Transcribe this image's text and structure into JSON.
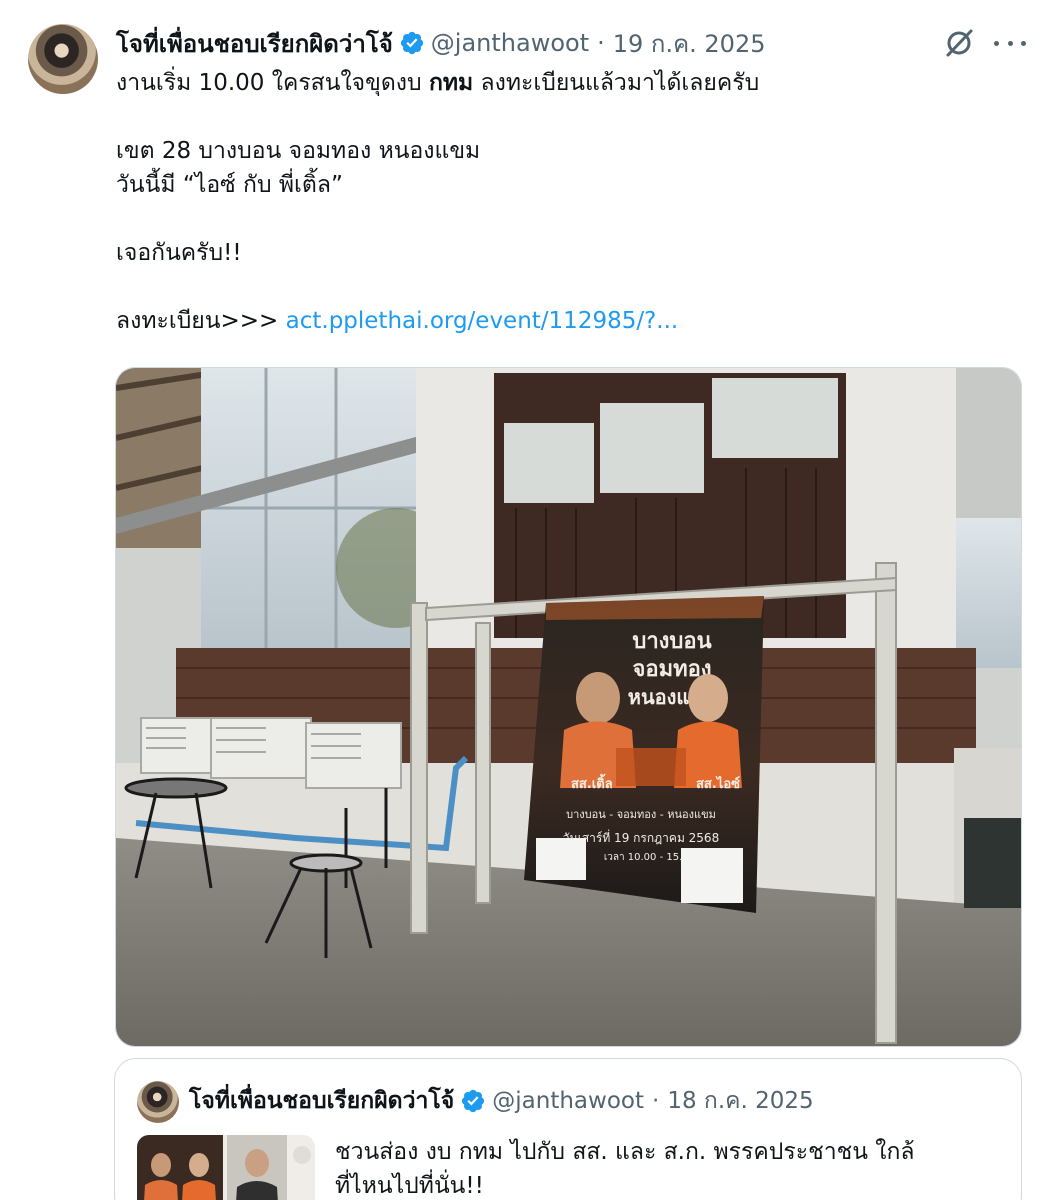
{
  "author": {
    "display_name": "โจที่เพื่อนชอบเรียกผิดว่าโจ้",
    "handle": "@janthawoot",
    "date": "19 ก.ค. 2025"
  },
  "separator": "·",
  "tweet": {
    "line1_before": "งานเริ่ม 10.00 ใครสนใจขุดงบ ",
    "line1_bold": "กทม",
    "line1_after": " ลงทะเบียนแล้วมาได้เลยครับ",
    "line2": "เขต 28 บางบอน จอมทอง หนองแขม",
    "line3": "วันนี้มี “ไอซ์ กับ พี่เติ้ล”",
    "line4": "เจอกันครับ!!",
    "register_label": "ลงทะเบียน>>> ",
    "link_text": "act.pplethai.org/event/112985/?..."
  },
  "photo": {
    "banner_title_1": "บางบอน",
    "banner_title_2": "จอมทอง",
    "banner_title_3": "หนองแขม",
    "banner_sub_1": "บางบอน - จอมทอง - หนองแขม",
    "banner_date": "วันเสาร์ที่ 19 กรกฎาคม 2568",
    "banner_time": "เวลา 10.00 - 15.00 น.",
    "left_mp": "สส.เติ้ล",
    "right_mp": "สส.ไอซ์"
  },
  "quoted": {
    "display_name": "โจที่เพื่อนชอบเรียกผิดว่าโจ้",
    "handle": "@janthawoot",
    "date": "18 ก.ค. 2025",
    "text_line1": "ชวนส่อง งบ กทม ไปกับ สส. และ ส.ก. พรรคประชาชน ใกล้",
    "text_line2": "ที่ไหนไปที่นั่น!!"
  },
  "colors": {
    "text": "#0f1419",
    "muted": "#536471",
    "link": "#1d9bf0",
    "verified": "#1d9bf0",
    "border": "#cfd9de",
    "party_orange": "#f47932"
  },
  "icons": [
    "verified-badge-icon",
    "grok-icon",
    "more-icon"
  ]
}
